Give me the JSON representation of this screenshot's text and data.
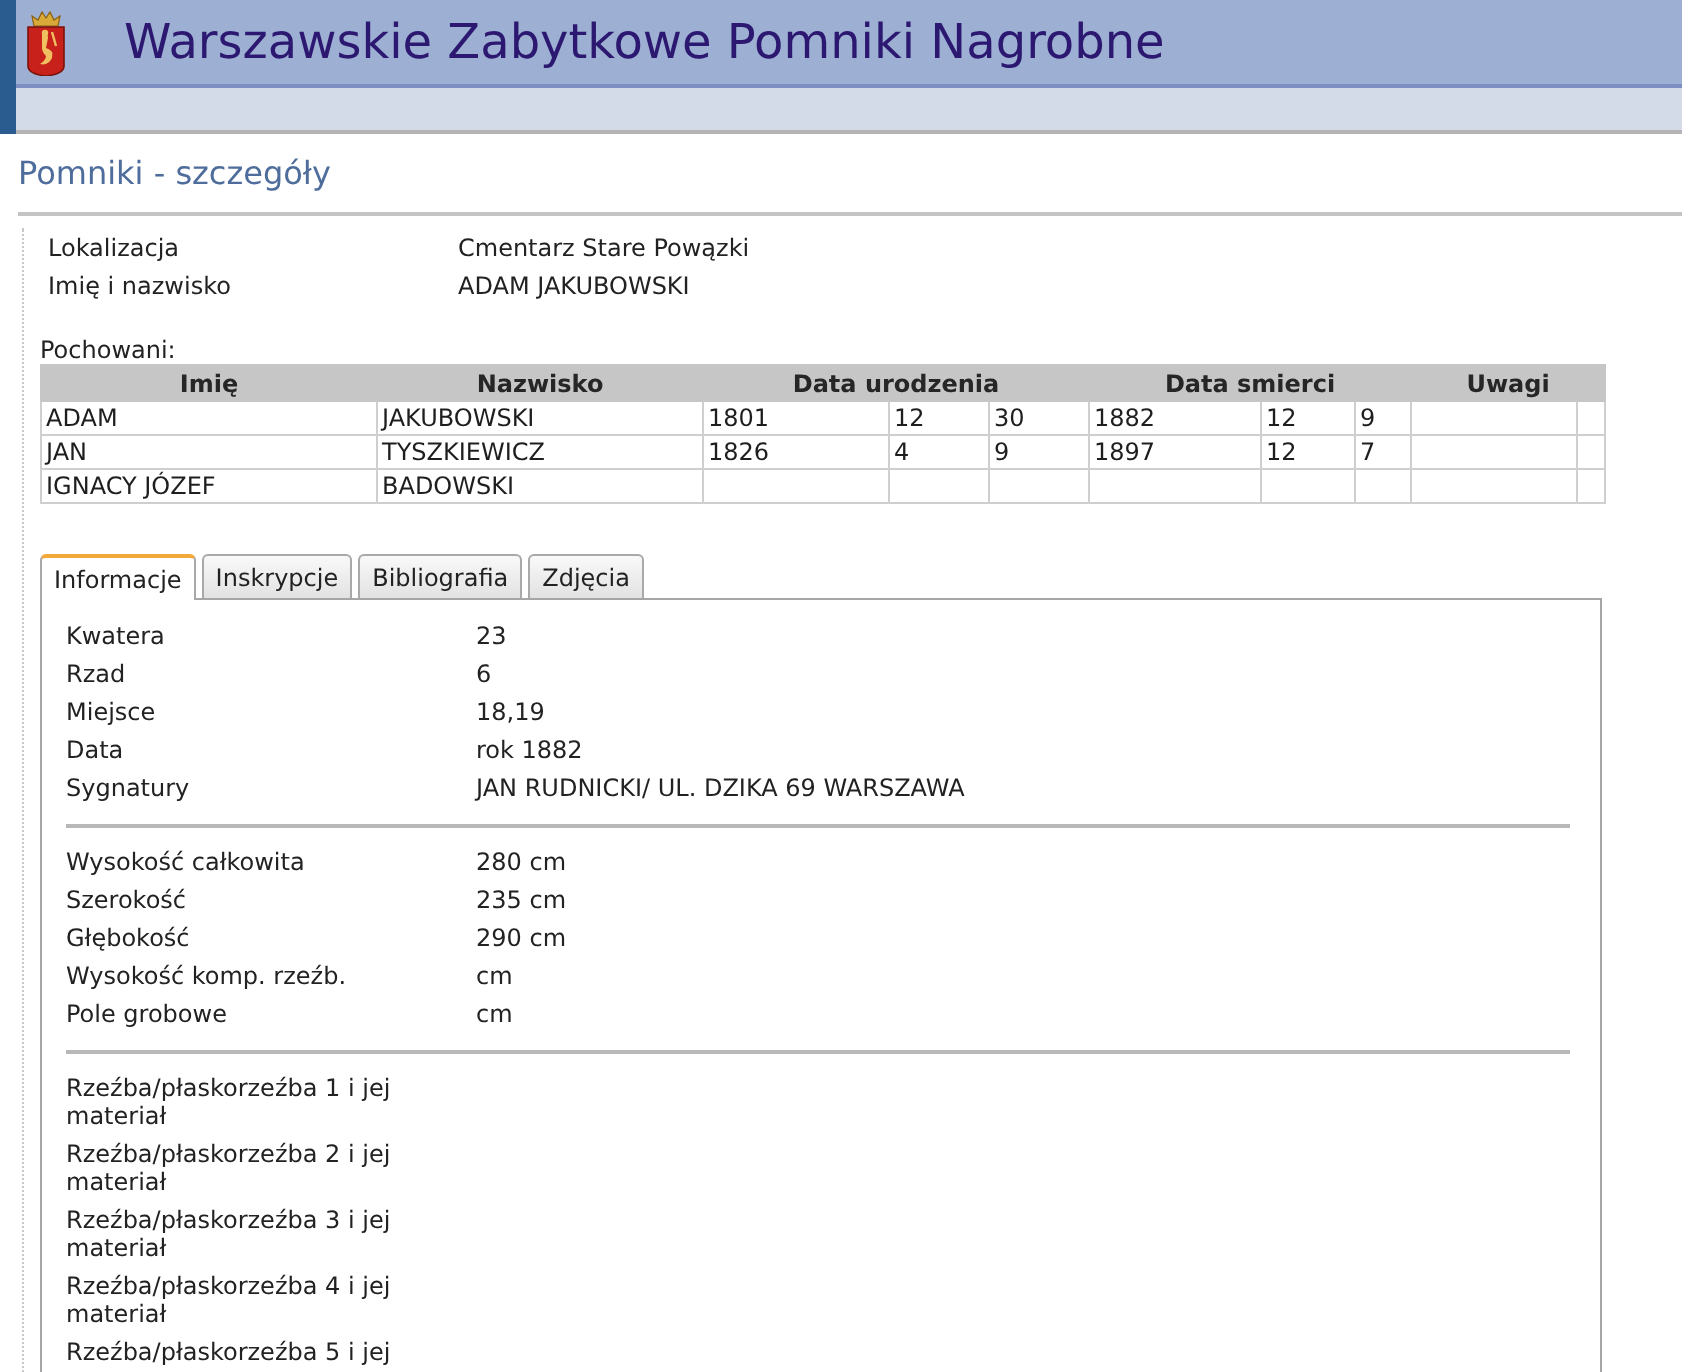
{
  "header": {
    "title": "Warszawskie Zabytkowe Pomniki Nagrobne"
  },
  "page_heading": "Pomniki - szczegóły",
  "summary": [
    {
      "label": "Lokalizacja",
      "value": "Cmentarz Stare Powązki"
    },
    {
      "label": "Imię i nazwisko",
      "value": "ADAM JAKUBOWSKI"
    }
  ],
  "buried": {
    "caption": "Pochowani:",
    "columns": [
      {
        "label": "Imię"
      },
      {
        "label": "Nazwisko"
      },
      {
        "label": "Data urodzenia",
        "colspan": 3
      },
      {
        "label": "Data smierci",
        "colspan": 3
      },
      {
        "label": "Uwagi",
        "colspan": 2
      }
    ],
    "rows": [
      [
        "ADAM",
        "JAKUBOWSKI",
        "1801",
        "12",
        "30",
        "1882",
        "12",
        "9"
      ],
      [
        "JAN",
        "TYSZKIEWICZ",
        "1826",
        "4",
        "9",
        "1897",
        "12",
        "7"
      ],
      [
        "IGNACY JÓZEF",
        "BADOWSKI"
      ]
    ]
  },
  "tabs": [
    {
      "label": "Informacje",
      "selected": true
    },
    {
      "label": "Inskrypcje",
      "selected": false
    },
    {
      "label": "Bibliografia",
      "selected": false
    },
    {
      "label": "Zdjęcia",
      "selected": false
    }
  ],
  "details": {
    "groups": [
      {
        "kind": "fields",
        "items": [
          {
            "label": "Kwatera",
            "value": "23"
          },
          {
            "label": "Rzad",
            "value": "6"
          },
          {
            "label": "Miejsce",
            "value": "18,19"
          },
          {
            "label": "Data",
            "value": "rok 1882"
          },
          {
            "label": "Sygnatury",
            "value": "JAN RUDNICKI/ UL. DZIKA 69 WARSZAWA"
          }
        ]
      },
      {
        "kind": "fields",
        "items": [
          {
            "label": "Wysokość całkowita",
            "value": "280 cm"
          },
          {
            "label": "Szerokość",
            "value": "235 cm"
          },
          {
            "label": "Głębokość",
            "value": "290 cm"
          },
          {
            "label": "Wysokość komp. rzeźb.",
            "value": "cm"
          },
          {
            "label": "Pole grobowe",
            "value": "cm"
          }
        ]
      },
      {
        "kind": "wrapped",
        "items": [
          {
            "label": "Rzeźba/płaskorzeźba 1 i jej materiał"
          },
          {
            "label": "Rzeźba/płaskorzeźba 2 i jej materiał"
          },
          {
            "label": "Rzeźba/płaskorzeźba 3 i jej materiał"
          },
          {
            "label": "Rzeźba/płaskorzeźba 4 i jej materiał"
          },
          {
            "label": "Rzeźba/płaskorzeźba 5 i jej"
          }
        ]
      }
    ]
  }
}
